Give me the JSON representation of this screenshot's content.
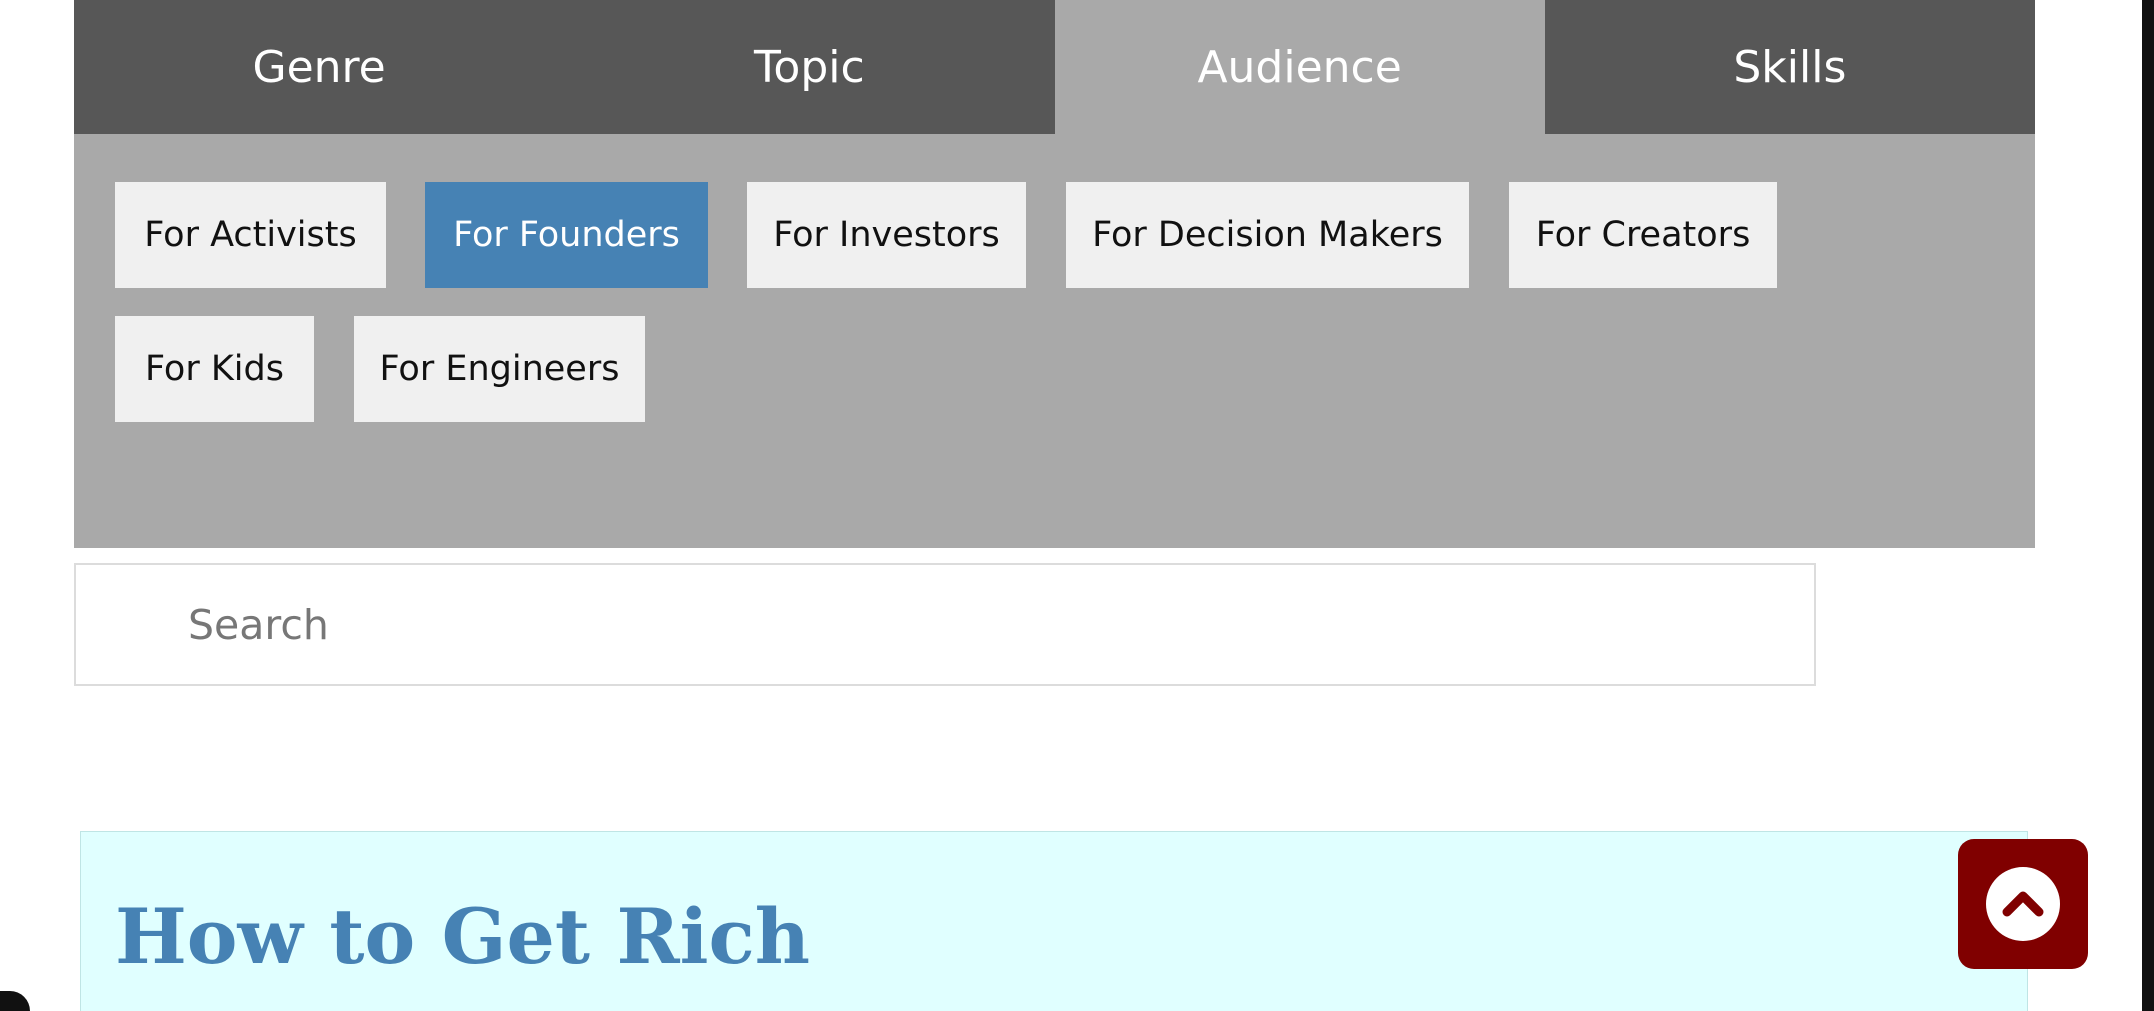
{
  "tabs": [
    {
      "label": "Genre",
      "active": false
    },
    {
      "label": "Topic",
      "active": false
    },
    {
      "label": "Audience",
      "active": true
    },
    {
      "label": "Skills",
      "active": false
    }
  ],
  "tags": [
    {
      "label": "For Activists",
      "active": false
    },
    {
      "label": "For Founders",
      "active": true
    },
    {
      "label": "For Investors",
      "active": false
    },
    {
      "label": "For Decision Makers",
      "active": false
    },
    {
      "label": "For Creators",
      "active": false
    },
    {
      "label": "For Kids",
      "active": false
    },
    {
      "label": "For Engineers",
      "active": false
    }
  ],
  "search": {
    "placeholder": "Search",
    "value": ""
  },
  "card": {
    "title": "How to Get Rich"
  },
  "back_to_top": {
    "icon": "chevron-up-icon"
  },
  "colors": {
    "tab_bg": "#575757",
    "tab_active_bg": "#a9a9a9",
    "tag_active_bg": "#4682b4",
    "card_bg": "#e0ffff",
    "title_color": "#4682b4",
    "back_to_top_bg": "#800000"
  }
}
